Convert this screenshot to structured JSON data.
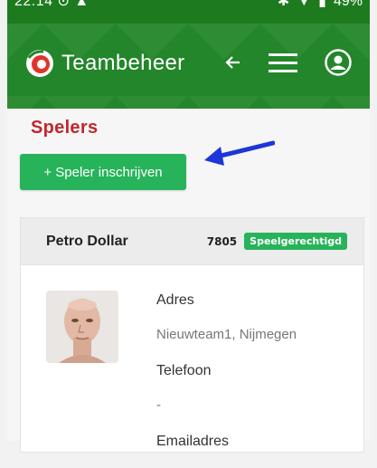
{
  "statusbar": {
    "time": "22:14",
    "battery": "49%"
  },
  "appbar": {
    "title": "Teambeheer"
  },
  "page": {
    "title": "Spelers",
    "add_button": "+ Speler inschrijven"
  },
  "player": {
    "name": "Petro Dollar",
    "number": "7805",
    "status": "Speelgerechtigd",
    "fields": [
      {
        "label": "Adres",
        "value": "Nieuwteam1, Nijmegen"
      },
      {
        "label": "Telefoon",
        "value": "-"
      },
      {
        "label": "Emailadres",
        "value": ""
      }
    ]
  },
  "colors": {
    "brand": "#23862a",
    "accent": "#27b35a",
    "title": "#c0282c",
    "arrow": "#1d36d8"
  },
  "icons": [
    "logo-icon",
    "back-arrow-icon",
    "menu-icon",
    "account-icon"
  ]
}
